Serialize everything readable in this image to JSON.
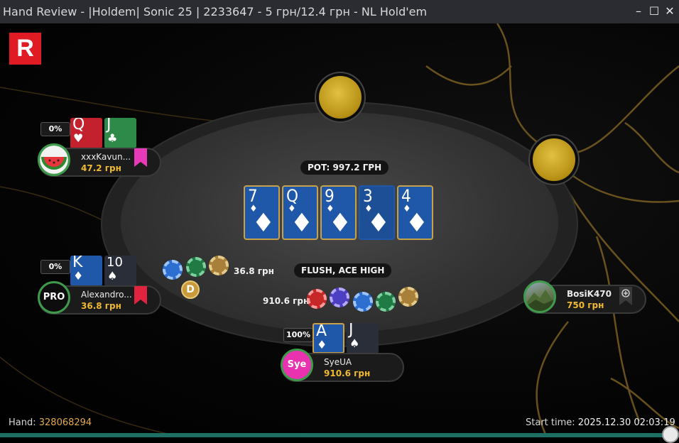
{
  "window": {
    "title": "Hand Review - |Holdem| Sonic 25 | 2233647 - 5 грн/12.4 грн - NL Hold'em",
    "minimize": "–",
    "maximize": "☐",
    "close": "✕"
  },
  "logo": "R",
  "pot": "POT: 997.2 ГРН",
  "hand_result": "FLUSH, ACE HIGH",
  "board": [
    {
      "rank": "7",
      "suit": "♦"
    },
    {
      "rank": "Q",
      "suit": "♦"
    },
    {
      "rank": "9",
      "suit": "♦"
    },
    {
      "rank": "3",
      "suit": "♦"
    },
    {
      "rank": "4",
      "suit": "♦"
    }
  ],
  "players": [
    {
      "name": "xxxKavun...",
      "stack": "47.2 грн",
      "equity": "0%",
      "cards": [
        {
          "rank": "Q",
          "suit": "♥"
        },
        {
          "rank": "J",
          "suit": "♣"
        }
      ]
    },
    {
      "name": "Alexandro...",
      "stack": "36.8 грн",
      "equity": "0%",
      "avatar_text": "PRO",
      "cards": [
        {
          "rank": "K",
          "suit": "♦"
        },
        {
          "rank": "10",
          "suit": "♠"
        }
      ]
    },
    {
      "name": "BosiK470",
      "stack": "750 грн"
    },
    {
      "name": "SyeUA",
      "stack": "910.6 грн",
      "equity": "100%",
      "avatar_text": "Sye",
      "cards": [
        {
          "rank": "A",
          "suit": "♦"
        },
        {
          "rank": "J",
          "suit": "♠"
        }
      ]
    }
  ],
  "bets": {
    "alexandro": "36.8 грн",
    "syeua": "910.6 грн"
  },
  "dealer_button": "D",
  "footer": {
    "hand_label": "Hand:",
    "hand_number": "328068294",
    "start_label": "Start time:",
    "start_time": "2025.12.30 02:03:19"
  },
  "replay_progress": 1.0,
  "colors": {
    "accent_gold": "#f0b930",
    "board_card": "#1f58a8",
    "brand_red": "#e01b24",
    "note_magenta": "#e83ab8",
    "note_red": "#e0243f"
  }
}
